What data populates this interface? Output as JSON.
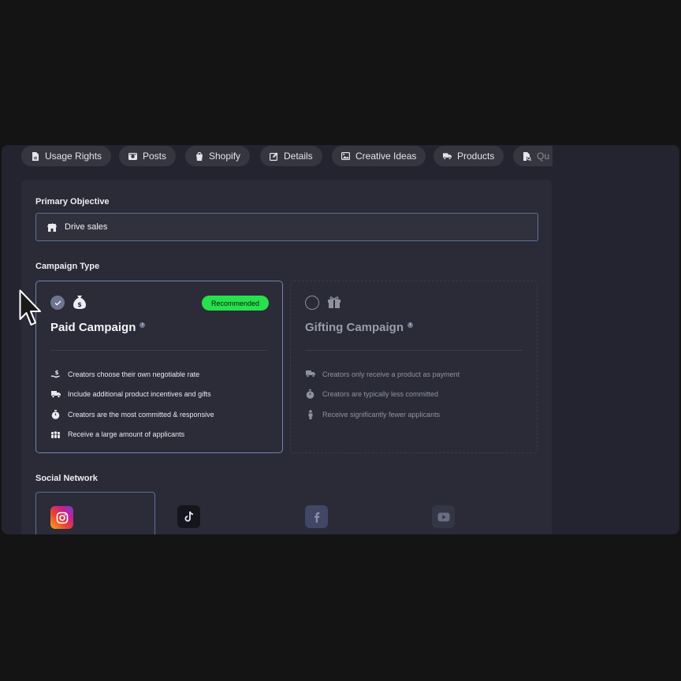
{
  "tabs": [
    {
      "label": "Usage Rights",
      "icon": "file-icon"
    },
    {
      "label": "Posts",
      "icon": "camera-icon"
    },
    {
      "label": "Shopify",
      "icon": "shopping-bag-icon"
    },
    {
      "label": "Details",
      "icon": "edit-icon"
    },
    {
      "label": "Creative Ideas",
      "icon": "image-icon"
    },
    {
      "label": "Products",
      "icon": "truck-icon"
    },
    {
      "label": "Qu",
      "icon": "file-search-icon"
    }
  ],
  "primary_objective": {
    "label": "Primary Objective",
    "value": "Drive sales",
    "icon": "store-icon"
  },
  "campaign_type": {
    "label": "Campaign Type",
    "paid": {
      "title": "Paid Campaign",
      "badge": "Recommended",
      "selected": true,
      "icon": "money-bag-icon",
      "features": [
        {
          "text": "Creators choose their own negotiable rate",
          "icon": "hand-dollar-icon"
        },
        {
          "text": "Include additional product incentives and gifts",
          "icon": "truck-icon"
        },
        {
          "text": "Creators are the most committed & responsive",
          "icon": "stopwatch-icon"
        },
        {
          "text": "Receive a large amount of applicants",
          "icon": "people-icon"
        }
      ]
    },
    "gifting": {
      "title": "Gifting Campaign",
      "selected": false,
      "icon": "gift-icon",
      "features": [
        {
          "text": "Creators only receive a product as payment",
          "icon": "truck-icon"
        },
        {
          "text": "Creators are typically less committed",
          "icon": "stopwatch-icon"
        },
        {
          "text": "Receive significantly fewer applicants",
          "icon": "person-icon"
        }
      ]
    }
  },
  "social_network": {
    "label": "Social Network",
    "networks": [
      {
        "name": "instagram-icon",
        "selected": true
      },
      {
        "name": "tiktok-icon",
        "selected": false
      },
      {
        "name": "facebook-icon",
        "selected": false
      },
      {
        "name": "youtube-icon",
        "selected": false
      }
    ]
  },
  "colors": {
    "background": "#141414",
    "panel": "#2a2b37",
    "accent_border": "#7282ad",
    "badge_green": "#27e14c"
  }
}
